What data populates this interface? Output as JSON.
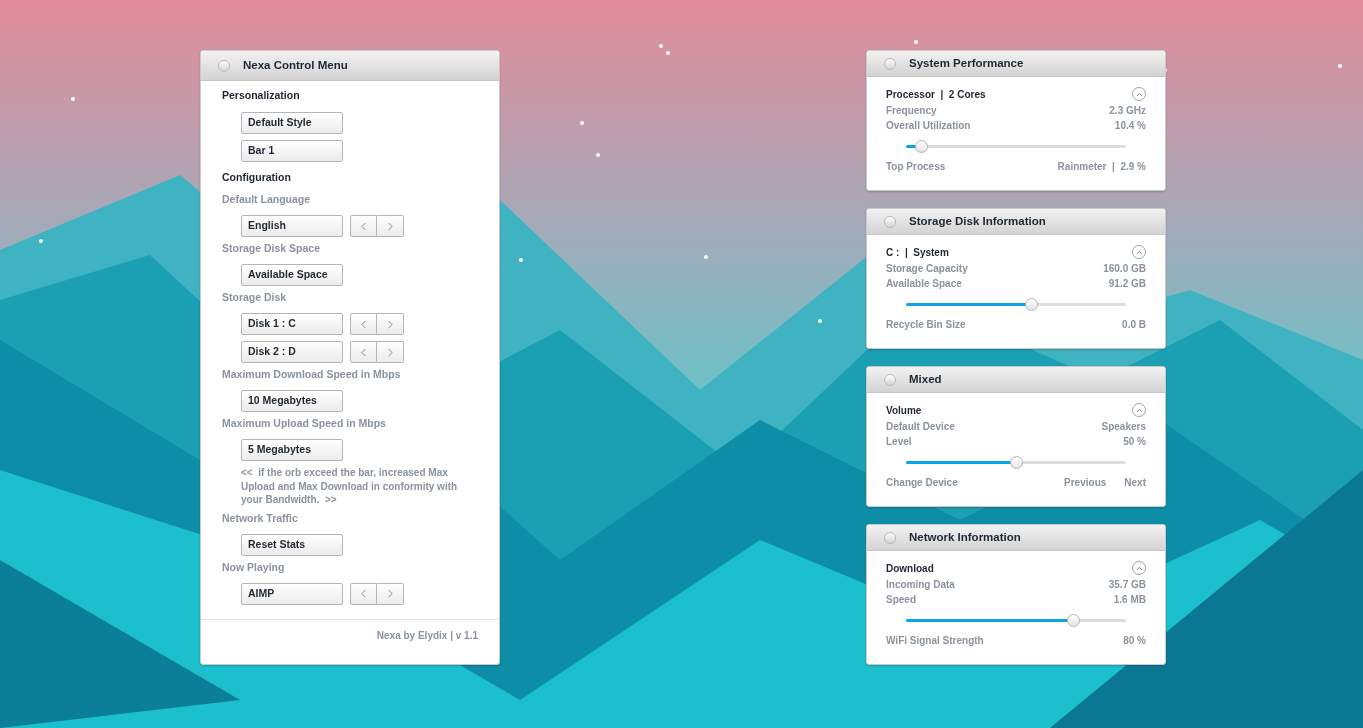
{
  "control_menu": {
    "title": "Nexa Control Menu",
    "items": [
      {
        "kind": "heading",
        "text": "Personalization"
      },
      {
        "kind": "button",
        "text": "Default Style"
      },
      {
        "kind": "button",
        "text": "Bar  1"
      },
      {
        "kind": "heading",
        "text": "Configuration"
      },
      {
        "kind": "label",
        "text": "Default Language"
      },
      {
        "kind": "selector",
        "text": "English"
      },
      {
        "kind": "label",
        "text": "Storage Disk Space"
      },
      {
        "kind": "button",
        "text": "Available Space"
      },
      {
        "kind": "label",
        "text": "Storage Disk"
      },
      {
        "kind": "selector",
        "text": "Disk 1 :  C"
      },
      {
        "kind": "selector",
        "text": "Disk 2 :  D"
      },
      {
        "kind": "label",
        "text": "Maximum Download Speed in Mbps"
      },
      {
        "kind": "button",
        "text": "10 Megabytes"
      },
      {
        "kind": "label",
        "text": "Maximum Upload Speed in Mbps"
      },
      {
        "kind": "button",
        "text": "5 Megabytes"
      },
      {
        "kind": "note",
        "text": "<<  if the orb exceed the bar, increased Max Upload and Max Download in conformity with your Bandwidth.  >>"
      },
      {
        "kind": "label",
        "text": "Network Traffic"
      },
      {
        "kind": "button",
        "text": "Reset Stats"
      },
      {
        "kind": "label",
        "text": "Now Playing"
      },
      {
        "kind": "selector",
        "text": "AIMP"
      }
    ],
    "footer": "Nexa by Elydix | v 1.1"
  },
  "widgets": [
    {
      "title": "System Performance",
      "heading": "Processor  |  2 Cores",
      "rows": [
        {
          "label": "Frequency",
          "value": "2.3 GHz"
        },
        {
          "label": "Overall Utilization",
          "value": "10.4 %"
        }
      ],
      "level": 0.07,
      "footer": {
        "label": "Top Process",
        "value": "Rainmeter  |  2.9 %"
      }
    },
    {
      "title": "Storage Disk Information",
      "heading": "C :  |  System",
      "rows": [
        {
          "label": "Storage Capacity",
          "value": "160.0 GB"
        },
        {
          "label": "Available Space",
          "value": "91.2 GB"
        }
      ],
      "level": 0.57,
      "footer": {
        "label": "Recycle Bin Size",
        "value": "0.0 B"
      }
    },
    {
      "title": "Mixed",
      "heading": "Volume",
      "rows": [
        {
          "label": "Default Device",
          "value": "Speakers"
        },
        {
          "label": "Level",
          "value": "50 %"
        }
      ],
      "level": 0.5,
      "footer": {
        "label": "Change Device",
        "actions": [
          "Previous",
          "Next"
        ]
      }
    },
    {
      "title": "Network Information",
      "heading": "Download",
      "rows": [
        {
          "label": "Incoming Data",
          "value": "35.7 GB"
        },
        {
          "label": "Speed",
          "value": "1.6 MB"
        }
      ],
      "level": 0.76,
      "footer": {
        "label": "WiFi Signal Strength",
        "value": "80 %"
      }
    }
  ]
}
